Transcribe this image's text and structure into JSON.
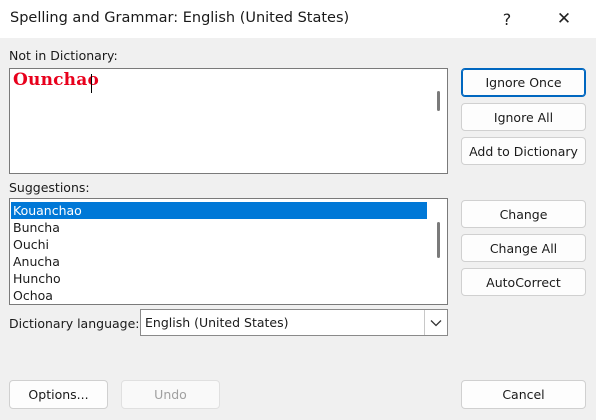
{
  "window": {
    "title": "Spelling and Grammar: English (United States)",
    "help_glyph": "?",
    "close_glyph": "✕"
  },
  "not_in_dictionary": {
    "label": "Not in Dictionary:",
    "word": "Ounchao"
  },
  "suggestions": {
    "label": "Suggestions:",
    "items": [
      "Kouanchao",
      "Buncha",
      "Ouchi",
      "Anucha",
      "Huncho",
      "Ochoa"
    ],
    "selected_index": 0
  },
  "buttons": {
    "ignore_once": "Ignore Once",
    "ignore_all": "Ignore All",
    "add_to_dictionary": "Add to Dictionary",
    "change": "Change",
    "change_all": "Change All",
    "autocorrect": "AutoCorrect",
    "options": "Options...",
    "undo": "Undo",
    "cancel": "Cancel"
  },
  "dictionary_language": {
    "label": "Dictionary language:",
    "value": "English (United States)"
  },
  "colors": {
    "misspelled": "#e8001c",
    "selection": "#0078d7",
    "default_button_border": "#0067c0"
  }
}
